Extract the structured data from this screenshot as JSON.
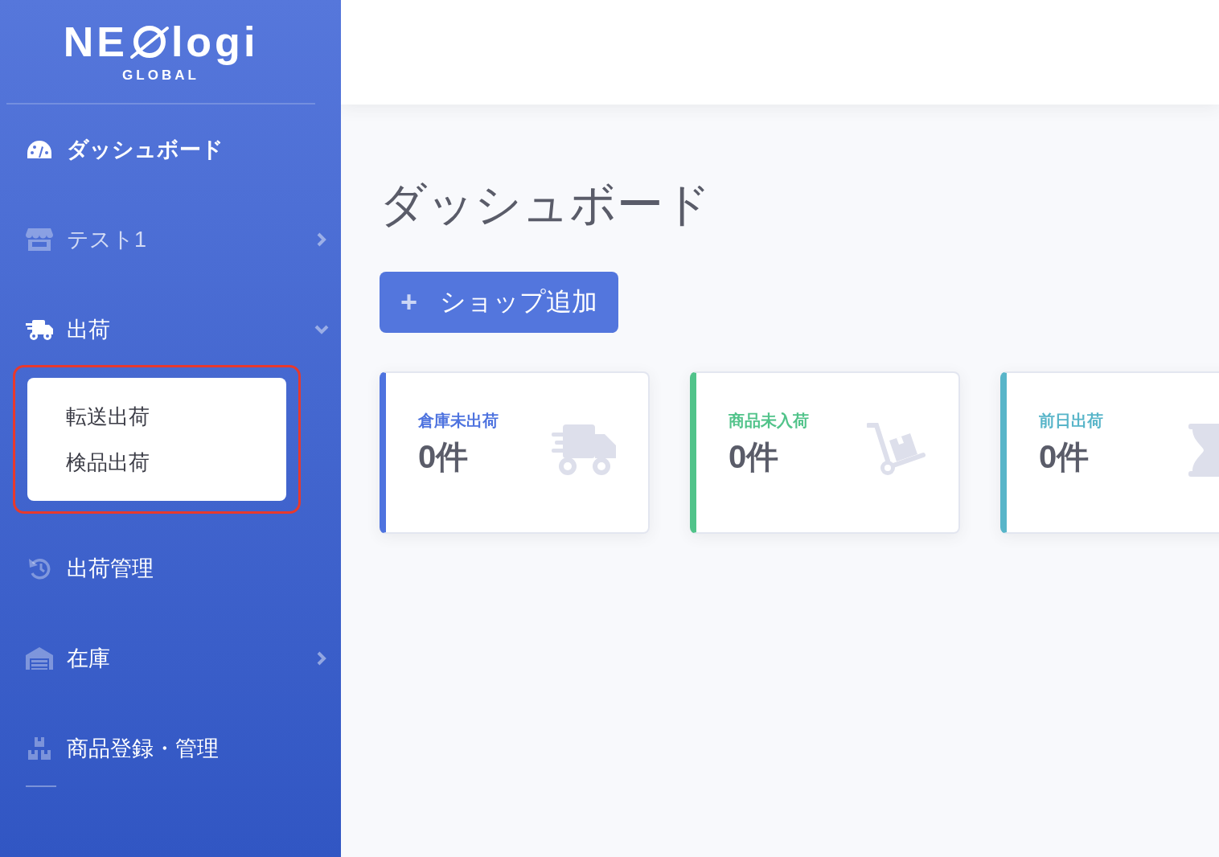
{
  "logo": {
    "prefix": "NE",
    "suffix": "logi",
    "tagline": "GLOBAL"
  },
  "sidebar": {
    "items": [
      {
        "label": "ダッシュボード",
        "kind": "link",
        "selected": true
      },
      {
        "label": "テスト1",
        "kind": "group",
        "selected": false,
        "expanded": false
      },
      {
        "label": "出荷",
        "kind": "group",
        "selected": false,
        "expanded": true,
        "highlighted": true,
        "children": [
          {
            "label": "転送出荷"
          },
          {
            "label": "検品出荷"
          }
        ]
      },
      {
        "label": "出荷管理",
        "kind": "link",
        "selected": false
      },
      {
        "label": "在庫",
        "kind": "group",
        "selected": false,
        "expanded": false
      },
      {
        "label": "商品登録・管理",
        "kind": "link",
        "selected": false
      }
    ]
  },
  "page_title": "ダッシュボード",
  "add_button": {
    "icon_text": "+",
    "label": "ショップ追加"
  },
  "cards": [
    {
      "label": "倉庫未出荷",
      "value": "0件",
      "color": "#4e73df"
    },
    {
      "label": "商品未入荷",
      "value": "0件",
      "color": "#51c38a"
    },
    {
      "label": "前日出荷",
      "value": "0件",
      "color": "#58b5c9"
    }
  ]
}
